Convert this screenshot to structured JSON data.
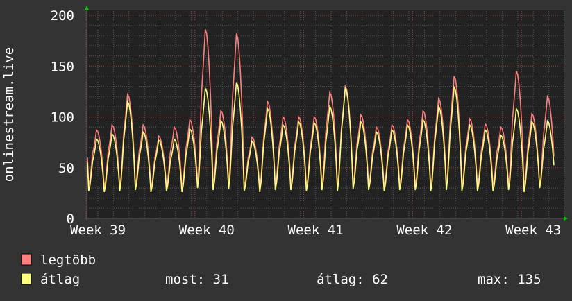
{
  "chart_data": {
    "type": "line",
    "ylabel": "onlinestream.live",
    "ylim": [
      0,
      200
    ],
    "yticks": [
      0,
      50,
      100,
      150,
      200
    ],
    "xticks": [
      "Week 39",
      "Week 40",
      "Week 41",
      "Week 42",
      "Week 43"
    ],
    "x_unit": "day",
    "grid": true,
    "series": [
      {
        "name": "legtöbb",
        "color": "#ff7f7f",
        "daily_peaks": [
          87,
          92,
          122,
          92,
          81,
          90,
          97,
          186,
          106,
          182,
          80,
          115,
          100,
          100,
          100,
          124,
          130,
          102,
          90,
          92,
          97,
          106,
          118,
          140,
          98,
          93,
          90,
          145,
          103,
          120
        ],
        "daily_troughs": [
          32,
          30,
          31,
          33,
          30,
          31,
          30,
          35,
          33,
          34,
          31,
          30,
          32,
          33,
          31,
          33,
          32,
          34,
          32,
          31,
          33,
          32,
          31,
          33,
          32,
          31,
          32,
          33,
          31,
          31
        ]
      },
      {
        "name": "átlag",
        "color": "#ffff7f",
        "daily_peaks": [
          78,
          83,
          115,
          85,
          77,
          78,
          88,
          128,
          96,
          134,
          76,
          108,
          92,
          95,
          94,
          110,
          128,
          95,
          85,
          87,
          92,
          97,
          110,
          129,
          92,
          87,
          82,
          108,
          95,
          96
        ],
        "daily_troughs": [
          27,
          26,
          27,
          28,
          26,
          27,
          26,
          30,
          28,
          29,
          27,
          26,
          28,
          28,
          27,
          28,
          27,
          29,
          28,
          27,
          28,
          28,
          27,
          28,
          27,
          27,
          27,
          28,
          26,
          30
        ]
      }
    ],
    "legend": {
      "placement": "bottom-left",
      "items": [
        {
          "label": "legtöbb",
          "color": "#ff7f7f"
        },
        {
          "label": "átlag",
          "color": "#ffff7f"
        }
      ],
      "stats": {
        "now_label": "most: 31",
        "avg_label": "átlag: 62",
        "max_label": "max: 135"
      }
    }
  }
}
